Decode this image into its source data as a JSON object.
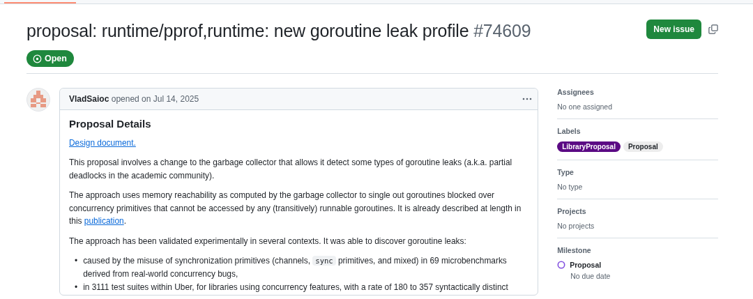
{
  "issue": {
    "title": "proposal: runtime/pprof,runtime: new goroutine leak profile",
    "number": "#74609",
    "state": "Open"
  },
  "header_actions": {
    "new_issue": "New issue"
  },
  "comment": {
    "author": "VladSaioc",
    "meta": "opened on Jul 14, 2025",
    "heading": "Proposal Details",
    "blocks": [
      {
        "kind": "paragraph",
        "parts": [
          {
            "kind": "link",
            "text": "Design document."
          }
        ]
      },
      {
        "kind": "paragraph",
        "parts": [
          {
            "kind": "text",
            "text": "This proposal involves a change to the garbage collector that allows it detect some types of goroutine leaks (a.k.a. partial deadlocks in the academic community)."
          }
        ]
      },
      {
        "kind": "paragraph",
        "parts": [
          {
            "kind": "text",
            "text": "The approach uses memory reachability as computed by the garbage collector to single out goroutines blocked over concurrency primitives that cannot be accessed by any (transitively) runnable goroutines. It is already described at length in this "
          },
          {
            "kind": "link",
            "text": "publication"
          },
          {
            "kind": "text",
            "text": "."
          }
        ]
      },
      {
        "kind": "paragraph",
        "parts": [
          {
            "kind": "text",
            "text": "The approach has been validated experimentally in several contexts. It was able to discover goroutine leaks:"
          }
        ]
      },
      {
        "kind": "list",
        "marker": "•",
        "items": [
          [
            {
              "kind": "text",
              "text": "caused by the misuse of synchronization primitives (channels, "
            },
            {
              "kind": "code",
              "text": "sync"
            },
            {
              "kind": "text",
              "text": " primitives, and mixed) in 69 microbenchmarks derived from real-world concurrency bugs,"
            }
          ],
          [
            {
              "kind": "text",
              "text": "in 3111 test suites within Uber, for libraries using concurrency features, with a rate of 180 to 357 syntactically distinct"
            }
          ]
        ]
      }
    ]
  },
  "sidebar": [
    {
      "kind": "text",
      "title": "Assignees",
      "value": "No one assigned"
    },
    {
      "kind": "labels",
      "title": "Labels",
      "labels": [
        {
          "name": "LibraryProposal",
          "color": "#5b0a84"
        },
        {
          "name": "Proposal",
          "color": "#ededed"
        }
      ]
    },
    {
      "kind": "text",
      "title": "Type",
      "value": "No type"
    },
    {
      "kind": "text",
      "title": "Projects",
      "value": "No projects"
    },
    {
      "kind": "milestone",
      "title": "Milestone",
      "name": "Proposal",
      "due": "No due date"
    }
  ]
}
